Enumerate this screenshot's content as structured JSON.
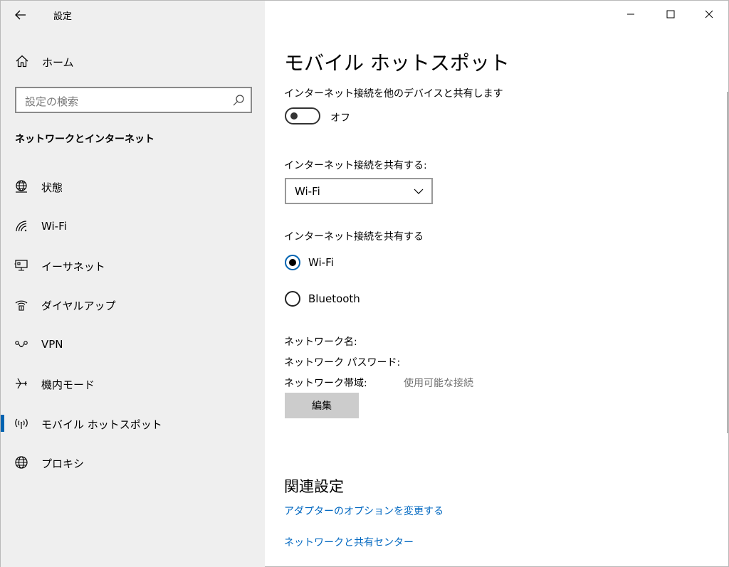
{
  "window": {
    "app_title": "設定",
    "controls": {
      "minimize": "minimize-icon",
      "maximize": "maximize-icon",
      "close": "close-icon"
    }
  },
  "sidebar": {
    "home_label": "ホーム",
    "search_placeholder": "設定の検索",
    "section_title": "ネットワークとインターネット",
    "items": [
      {
        "label": "状態",
        "icon": "globe-status-icon",
        "selected": false
      },
      {
        "label": "Wi-Fi",
        "icon": "wifi-icon",
        "selected": false
      },
      {
        "label": "イーサネット",
        "icon": "ethernet-icon",
        "selected": false
      },
      {
        "label": "ダイヤルアップ",
        "icon": "dialup-icon",
        "selected": false
      },
      {
        "label": "VPN",
        "icon": "vpn-icon",
        "selected": false
      },
      {
        "label": "機内モード",
        "icon": "airplane-icon",
        "selected": false
      },
      {
        "label": "モバイル ホットスポット",
        "icon": "hotspot-icon",
        "selected": true
      },
      {
        "label": "プロキシ",
        "icon": "proxy-globe-icon",
        "selected": false
      }
    ],
    "accent_color": "#0063b1"
  },
  "main": {
    "page_title": "モバイル ホットスポット",
    "share_label": "インターネット接続を他のデバイスと共有します",
    "toggle_state": "オフ",
    "share_from_label": "インターネット接続を共有する:",
    "share_from_value": "Wi-Fi",
    "share_over_label": "インターネット接続を共有する",
    "share_over_options": [
      {
        "label": "Wi-Fi",
        "checked": true
      },
      {
        "label": "Bluetooth",
        "checked": false
      }
    ],
    "network_name_label": "ネットワーク名:",
    "network_password_label": "ネットワーク パスワード:",
    "network_band_label": "ネットワーク帯域:",
    "network_band_value": "使用可能な接続",
    "edit_button": "編集",
    "related_title": "関連設定",
    "links": [
      "アダプターのオプションを変更する",
      "ネットワークと共有センター"
    ],
    "link_color": "#0067c0"
  }
}
